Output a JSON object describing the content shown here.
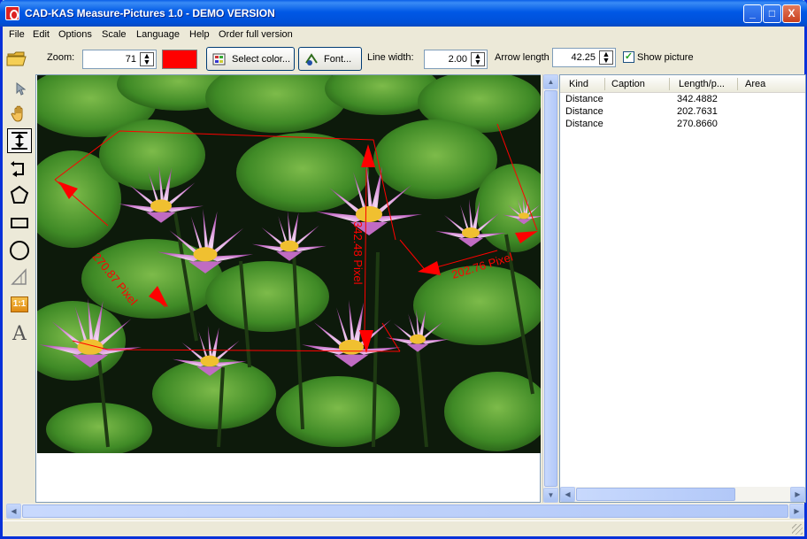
{
  "window": {
    "title": "CAD-KAS Measure-Pictures 1.0 - DEMO VERSION",
    "minimize_glyph": "_",
    "maximize_glyph": "□",
    "close_glyph": "X"
  },
  "menu": [
    "File",
    "Edit",
    "Options",
    "Scale",
    "Language",
    "Help",
    "Order full version"
  ],
  "toolbar": {
    "zoom_label": "Zoom:",
    "zoom_value": "71",
    "color_value": "#ff0000",
    "select_color_label": "Select color...",
    "font_label": "Font...",
    "line_width_label": "Line width:",
    "line_width_value": "2.00",
    "arrow_length_label": "Arrow length",
    "arrow_length_value": "42.25",
    "show_picture_label": "Show picture",
    "show_picture_checked": true
  },
  "tools": [
    {
      "name": "open-folder-icon"
    },
    {
      "name": "pointer-icon"
    },
    {
      "name": "hand-icon"
    },
    {
      "name": "distance-icon",
      "active": true
    },
    {
      "name": "angle-icon"
    },
    {
      "name": "polygon-icon"
    },
    {
      "name": "rectangle-icon"
    },
    {
      "name": "circle-icon"
    },
    {
      "name": "triangle-icon"
    },
    {
      "name": "scale-icon",
      "text": "1:1"
    },
    {
      "name": "text-icon",
      "text": "A"
    }
  ],
  "measurements": {
    "labels": [
      "270.87 Pixel",
      "342.48 Pixel",
      "202.76 Pixel"
    ]
  },
  "results_table": {
    "columns": [
      "Kind",
      "Caption",
      "Length/p...",
      "Area"
    ],
    "rows": [
      {
        "kind": "Distance",
        "caption": "",
        "length": "342.4882",
        "area": ""
      },
      {
        "kind": "Distance",
        "caption": "",
        "length": "202.7631",
        "area": ""
      },
      {
        "kind": "Distance",
        "caption": "",
        "length": "270.8660",
        "area": ""
      }
    ]
  },
  "colors": {
    "titlebar": "#0058e6",
    "measure": "#ff0000",
    "window_bg": "#ece9d8"
  }
}
